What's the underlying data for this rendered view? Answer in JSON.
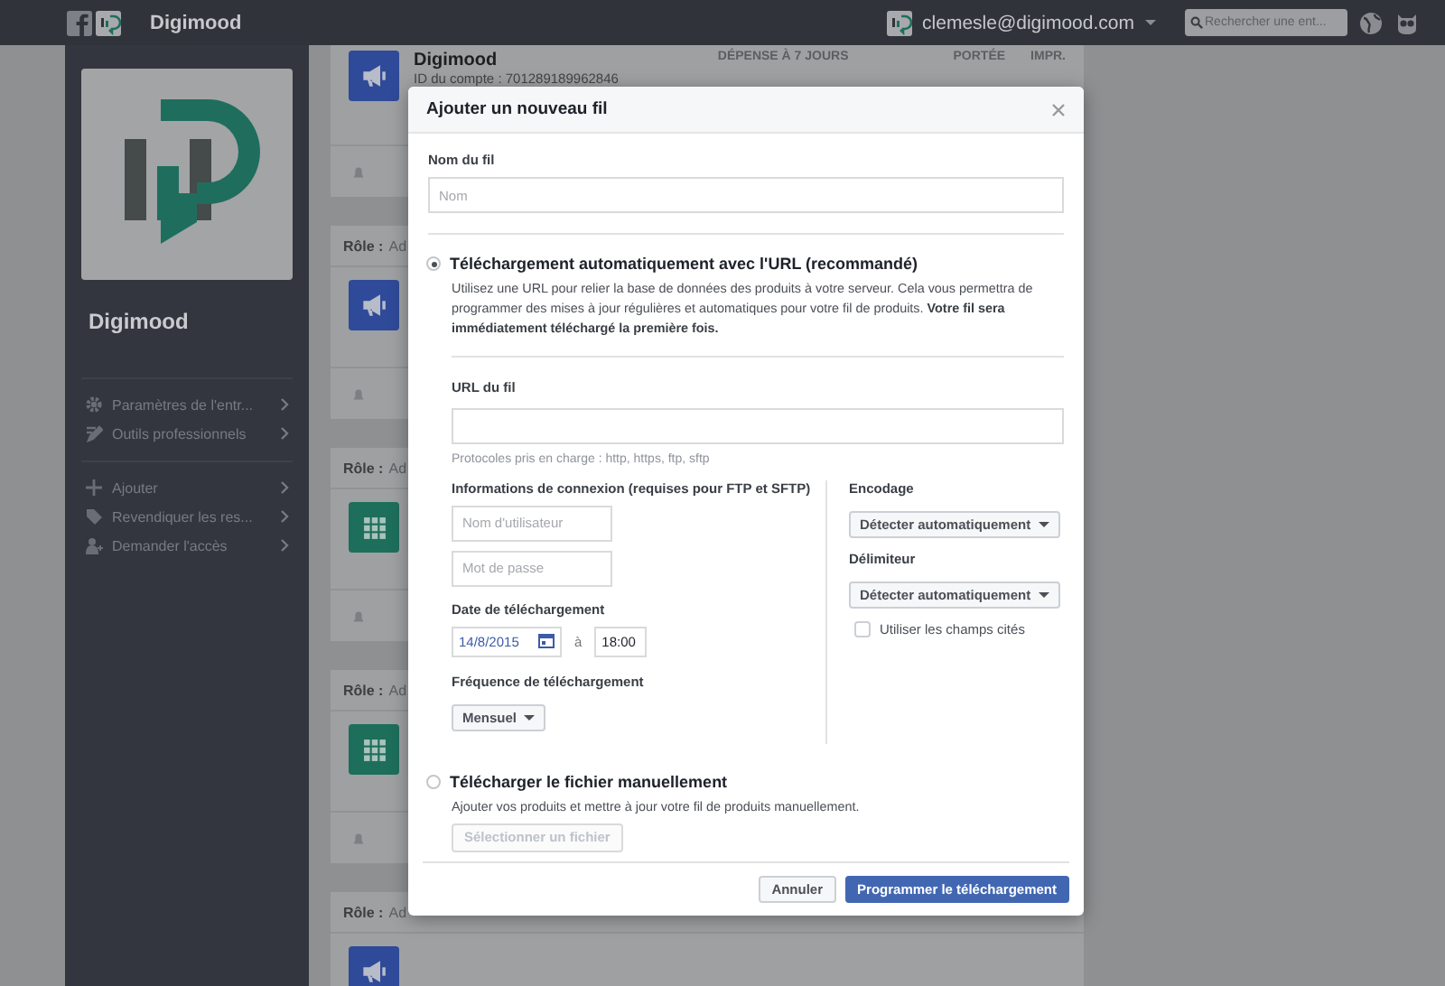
{
  "topbar": {
    "brand": "Digimood",
    "email": "clemesle@digimood.com",
    "search": {
      "placeholder": "Rechercher une ent..."
    }
  },
  "sidebar": {
    "title": "Digimood",
    "groups": [
      [
        {
          "label": "Paramètres de l'entr..."
        },
        {
          "label": "Outils professionnels"
        }
      ],
      [
        {
          "label": "Ajouter"
        },
        {
          "label": "Revendiquer les res..."
        },
        {
          "label": "Demander l'accès"
        }
      ]
    ]
  },
  "account_card": {
    "name": "Digimood",
    "account_id": "ID du compte : 701289189962846",
    "columns": [
      "DÉPENSE À 7 JOURS",
      "PORTÉE",
      "IMPR."
    ]
  },
  "role_cards": [
    {
      "kind": "ad_account",
      "role_label": "Rôle :",
      "role_value": "Ad"
    },
    {
      "kind": "catalog",
      "role_label": "Rôle :",
      "role_value": "Ad"
    },
    {
      "kind": "catalog",
      "role_label": "Rôle :",
      "role_value": "Ad"
    },
    {
      "kind": "ad_account",
      "role_label": "Rôle :",
      "role_value": "Ad"
    }
  ],
  "dialog": {
    "title": "Ajouter un nouveau fil",
    "name_field": {
      "label": "Nom du fil",
      "placeholder": "Nom"
    },
    "options": [
      {
        "kind": "url",
        "label": "Téléchargement automatiquement avec l'URL (recommandé)",
        "selected": true,
        "description": "Utilisez une URL pour relier la base de données des produits à votre serveur. Cela vous permettra de programmer des mises à jour régulières et automatiques pour votre fil de produits. **Votre fil sera immédiatement téléchargé la première fois.**"
      },
      {
        "kind": "manual",
        "label": "Télécharger le fichier manuellement",
        "selected": false,
        "description": "Ajouter vos produits et mettre à jour votre fil de produits manuellement.",
        "button": {
          "label": "Sélectionner un fichier",
          "disabled": true
        }
      }
    ],
    "url_settings": {
      "url_field": {
        "label": "URL du fil"
      },
      "hint": "Protocoles pris en charge : http, https, ftp, sftp",
      "login": {
        "label": "Informations de connexion (requises pour FTP et SFTP)",
        "username": {
          "placeholder": "Nom d'utilisateur"
        },
        "password": {
          "placeholder": "Mot de passe"
        }
      },
      "date": {
        "label": "Date de téléchargement",
        "date": "14/8/2015",
        "separator": "à",
        "time": "18:00"
      },
      "frequency": {
        "label": "Fréquence de téléchargement",
        "value": "Mensuel"
      },
      "encoding": {
        "label": "Encodage",
        "value": "Détecter automatiquement"
      },
      "delimiter": {
        "label": "Délimiteur",
        "value": "Détecter automatiquement"
      },
      "quoted_fields": {
        "label": "Utiliser les champs cités",
        "checked": false
      }
    },
    "buttons": [
      {
        "label": "Annuler",
        "primary": false
      },
      {
        "label": "Programmer le téléchargement",
        "primary": true
      }
    ]
  }
}
